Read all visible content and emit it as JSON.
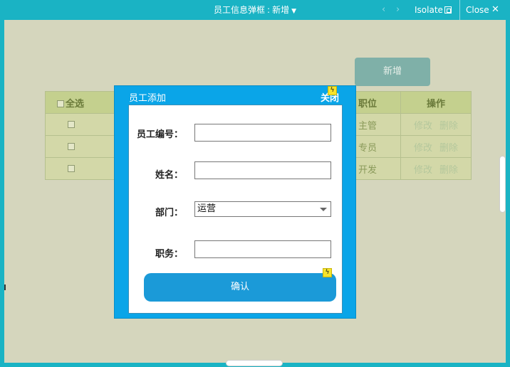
{
  "titlebar": {
    "title": "员工信息弹框",
    "separator": ":",
    "state": "新增",
    "nav_prev": "‹",
    "nav_next": "›",
    "isolate_label": "Isolate",
    "close_label": "Close",
    "close_icon_glyph": "✕"
  },
  "background": {
    "new_button_label": "新增",
    "table": {
      "header_select_all": "全选",
      "header_position": "职位",
      "header_actions": "操作",
      "rows": [
        {
          "position": "主管",
          "edit": "修改",
          "delete": "删除"
        },
        {
          "position": "专员",
          "edit": "修改",
          "delete": "删除"
        },
        {
          "position": "开发",
          "edit": "修改",
          "delete": "删除"
        }
      ]
    }
  },
  "modal": {
    "title": "员工添加",
    "close_label": "关闭",
    "fields": {
      "employee_id_label": "员工编号：",
      "employee_id_value": "",
      "name_label": "姓名：",
      "name_value": "",
      "department_label": "部门：",
      "department_value": "运营",
      "position_label": "职务：",
      "position_value": ""
    },
    "confirm_label": "确认",
    "bolt_glyph": "ϟ"
  },
  "colors": {
    "titlebar": "#1ab3c4",
    "canvas": "#d5d6bd",
    "modal": "#0aa5e8",
    "confirm_button": "#1b9ad8",
    "bolt": "#f6e32b"
  }
}
